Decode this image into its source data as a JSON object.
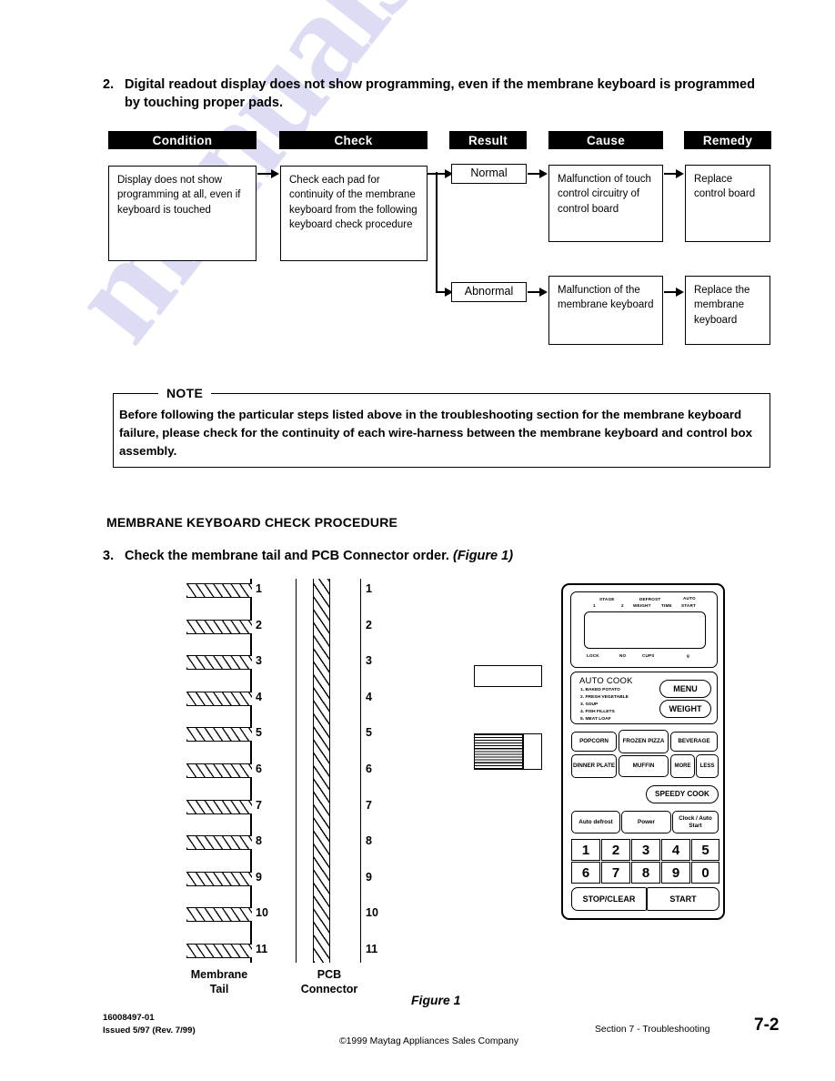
{
  "watermark": {
    "text": "manualslive.com"
  },
  "item2": {
    "number": "2.",
    "text": "Digital readout display does not show programming, even if the membrane keyboard is programmed by touching proper pads."
  },
  "flowchart": {
    "headers": [
      "Condition",
      "Check",
      "Result",
      "Cause",
      "Remedy"
    ],
    "condition": "Display does not show programming at all, even if keyboard is touched",
    "check": "Check each pad for continuity of the membrane keyboard from the following keyboard check procedure",
    "branches": [
      {
        "result": "Normal",
        "cause": "Malfunction of touch control circuitry of control board",
        "remedy": "Replace control board"
      },
      {
        "result": "Abnormal",
        "cause": "Malfunction of the membrane keyboard",
        "remedy": "Replace the membrane keyboard"
      }
    ]
  },
  "note": {
    "label": "NOTE",
    "text": "Before following the particular steps listed above in the troubleshooting section for the membrane keyboard failure, please check for the continuity of each wire-harness between the membrane keyboard and control box assembly."
  },
  "section_heading": "MEMBRANE KEYBOARD CHECK PROCEDURE",
  "item3": {
    "number": "3.",
    "text": "Check the membrane tail and PCB Connector order.",
    "figure_ref": "(Figure 1)"
  },
  "diagram": {
    "pin_numbers": [
      "1",
      "2",
      "3",
      "4",
      "5",
      "6",
      "7",
      "8",
      "9",
      "10",
      "11"
    ],
    "tail_label_line1": "Membrane",
    "tail_label_line2": "Tail",
    "pcb_label_line1": "PCB",
    "pcb_label_line2": "Connector"
  },
  "control_panel": {
    "display": {
      "stage_group": "STAGE",
      "stage_1": "1",
      "stage_2": "2",
      "defrost_group": "DEFROST",
      "defrost_weight": "WEIGHT",
      "defrost_time": "TIME",
      "auto_start_line1": "AUTO",
      "auto_start_line2": "START",
      "lock": "LOCK",
      "no": "NO",
      "cups": "CUPS",
      "small_indicator": "g"
    },
    "auto_cook": {
      "title": "AUTO COOK",
      "items": [
        "1. BAKED POTATO",
        "2. FRESH VEGETABLE",
        "3. SOUP",
        "4. FISH FILLETS",
        "5. MEAT LOAF"
      ],
      "menu_button": "MENU",
      "weight_button": "WEIGHT"
    },
    "row1": [
      "POPCORN",
      "FROZEN PIZZA",
      "BEVERAGE"
    ],
    "row2": [
      "DINNER PLATE",
      "MUFFIN",
      "MORE",
      "LESS"
    ],
    "speedy_cook": "SPEEDY COOK",
    "row3": [
      "Auto defrost",
      "Power",
      "Clock / Auto Start"
    ],
    "keypad_row1": [
      "1",
      "2",
      "3",
      "4",
      "5"
    ],
    "keypad_row2": [
      "6",
      "7",
      "8",
      "9",
      "0"
    ],
    "stop_clear": "STOP/CLEAR",
    "start": "START"
  },
  "figure_caption": "Figure 1",
  "footer": {
    "doc_number": "16008497-01",
    "issued": "Issued 5/97 (Rev. 7/99)",
    "copyright": "©1999 Maytag Appliances Sales Company",
    "section": "Section 7 - Troubleshooting",
    "page": "7-2"
  }
}
